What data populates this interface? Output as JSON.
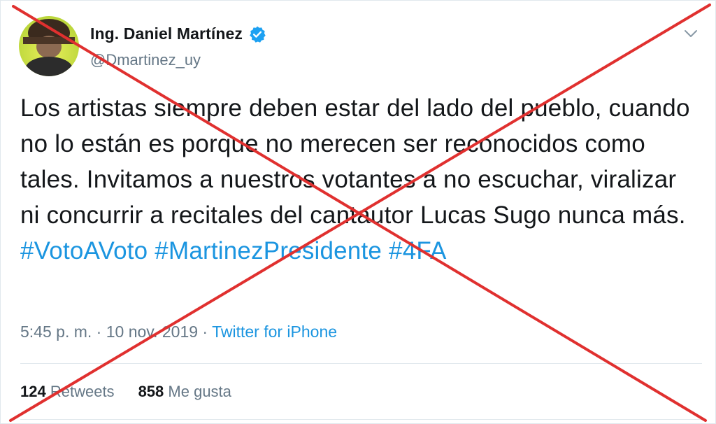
{
  "author": {
    "display_name": "Ing. Daniel Martínez",
    "handle": "@Dmartinez_uy",
    "verified": true
  },
  "tweet": {
    "text_segments": [
      "Los artistas siempre deben estar del lado del pueblo, cuando no lo están es porque no merecen ser reconocidos como tales. Invitamos a nuestros votantes a no escuchar, viralizar ni concurrir a recitales del cantautor Lucas Sugo nunca más. "
    ],
    "hashtags": [
      "#VotoAVoto",
      "#MartinezPresidente",
      "#4FA"
    ]
  },
  "meta": {
    "time": "5:45 p. m.",
    "separator": "·",
    "date": "10 nov. 2019",
    "source": "Twitter for iPhone"
  },
  "stats": {
    "retweets_count": "124",
    "retweets_label": "Retweets",
    "likes_count": "858",
    "likes_label": "Me gusta"
  },
  "colors": {
    "hashtag": "#1b95e0",
    "secondary_text": "#657786",
    "cross": "#e0302f",
    "verified": "#1da1f2"
  },
  "icons": {
    "verified": "verified-badge-icon",
    "chevron": "chevron-down-icon",
    "overlay": "red-x-overlay"
  }
}
